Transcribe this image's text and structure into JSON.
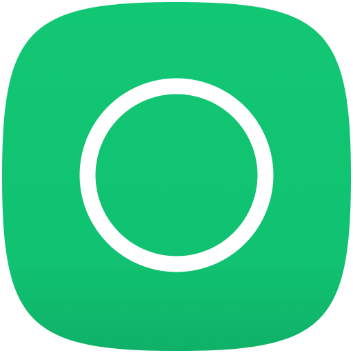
{
  "app_icon": {
    "name": "circle-app-icon",
    "icon": "ring-icon",
    "colors": {
      "background": "#ffffff",
      "tile_top": "#12c774",
      "tile_bottom": "#0fb168",
      "ring": "#ffffff"
    }
  }
}
